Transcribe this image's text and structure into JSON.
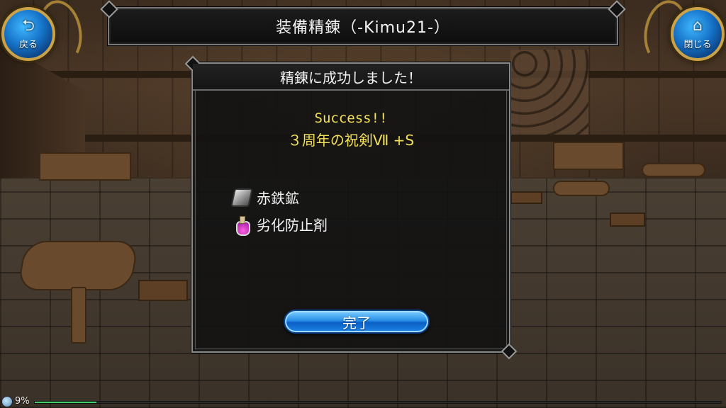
{
  "header": {
    "title": "装備精錬（-Kimu21-）"
  },
  "nav": {
    "back": {
      "label": "戻る",
      "icon": "back-arrow-icon"
    },
    "close": {
      "label": "閉じる",
      "icon": "home-icon"
    }
  },
  "dialog": {
    "title": "精錬に成功しました！",
    "success_text": "Success!!",
    "item_name": "３周年の祝剣Ⅶ +S",
    "materials": [
      {
        "name": "赤鉄鉱",
        "icon": "ore-ingot-icon"
      },
      {
        "name": "劣化防止剤",
        "icon": "potion-flask-icon"
      }
    ],
    "complete_label": "完了"
  },
  "status": {
    "percent_text": "9%",
    "progress": 0.09
  },
  "colors": {
    "highlight_text": "#f3e05a",
    "button_blue": "#2a90e8",
    "progress_green": "#3fd06a"
  }
}
